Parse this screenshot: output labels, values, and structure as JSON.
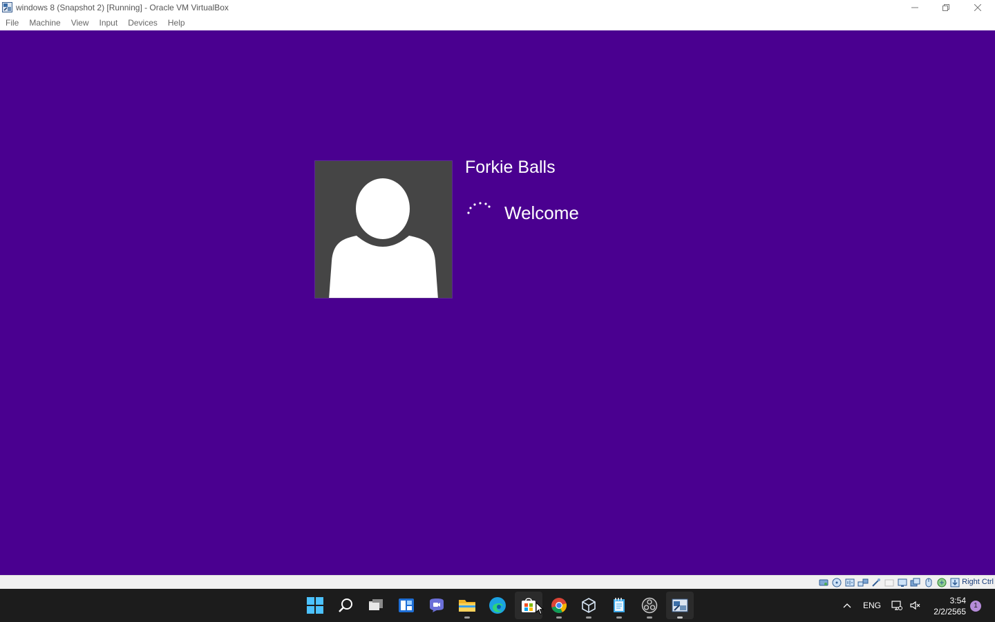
{
  "window": {
    "title": "windows 8 (Snapshot 2) [Running] - Oracle VM VirtualBox",
    "icon": "virtualbox-icon",
    "controls": [
      "minimize-icon",
      "restore-icon",
      "close-icon"
    ]
  },
  "menu": {
    "items": [
      "File",
      "Machine",
      "View",
      "Input",
      "Devices",
      "Help"
    ]
  },
  "vm": {
    "background": "#4a0090",
    "user_name": "Forkie Balls",
    "status": "Welcome",
    "avatar_icon": "user-silhouette-icon"
  },
  "vbox_status": {
    "icons": [
      "hard-disk-icon",
      "optical-drive-icon",
      "audio-icon",
      "network-icon",
      "usb-icon",
      "shared-folders-icon",
      "display-icon",
      "video-capture-icon",
      "mouse-integration-icon",
      "cpu-icon",
      "keyboard-capture-icon"
    ],
    "host_key": "Right Ctrl"
  },
  "taskbar": {
    "apps": [
      {
        "name": "start",
        "icon": "windows-start-icon"
      },
      {
        "name": "search",
        "icon": "search-icon"
      },
      {
        "name": "task-view",
        "icon": "task-view-icon"
      },
      {
        "name": "widgets",
        "icon": "widgets-icon"
      },
      {
        "name": "chat",
        "icon": "teams-chat-icon"
      },
      {
        "name": "file-explorer",
        "icon": "folder-icon"
      },
      {
        "name": "edge",
        "icon": "edge-icon"
      },
      {
        "name": "store",
        "icon": "store-icon"
      },
      {
        "name": "chrome",
        "icon": "chrome-icon"
      },
      {
        "name": "virtualbox",
        "icon": "virtualbox-icon"
      },
      {
        "name": "notepad",
        "icon": "notepad-icon"
      },
      {
        "name": "obs",
        "icon": "obs-icon"
      },
      {
        "name": "vm-window",
        "icon": "vm-window-icon"
      }
    ],
    "tray": {
      "language": "ENG",
      "time": "3:54",
      "date": "2/2/2565",
      "notifications": "1"
    }
  }
}
